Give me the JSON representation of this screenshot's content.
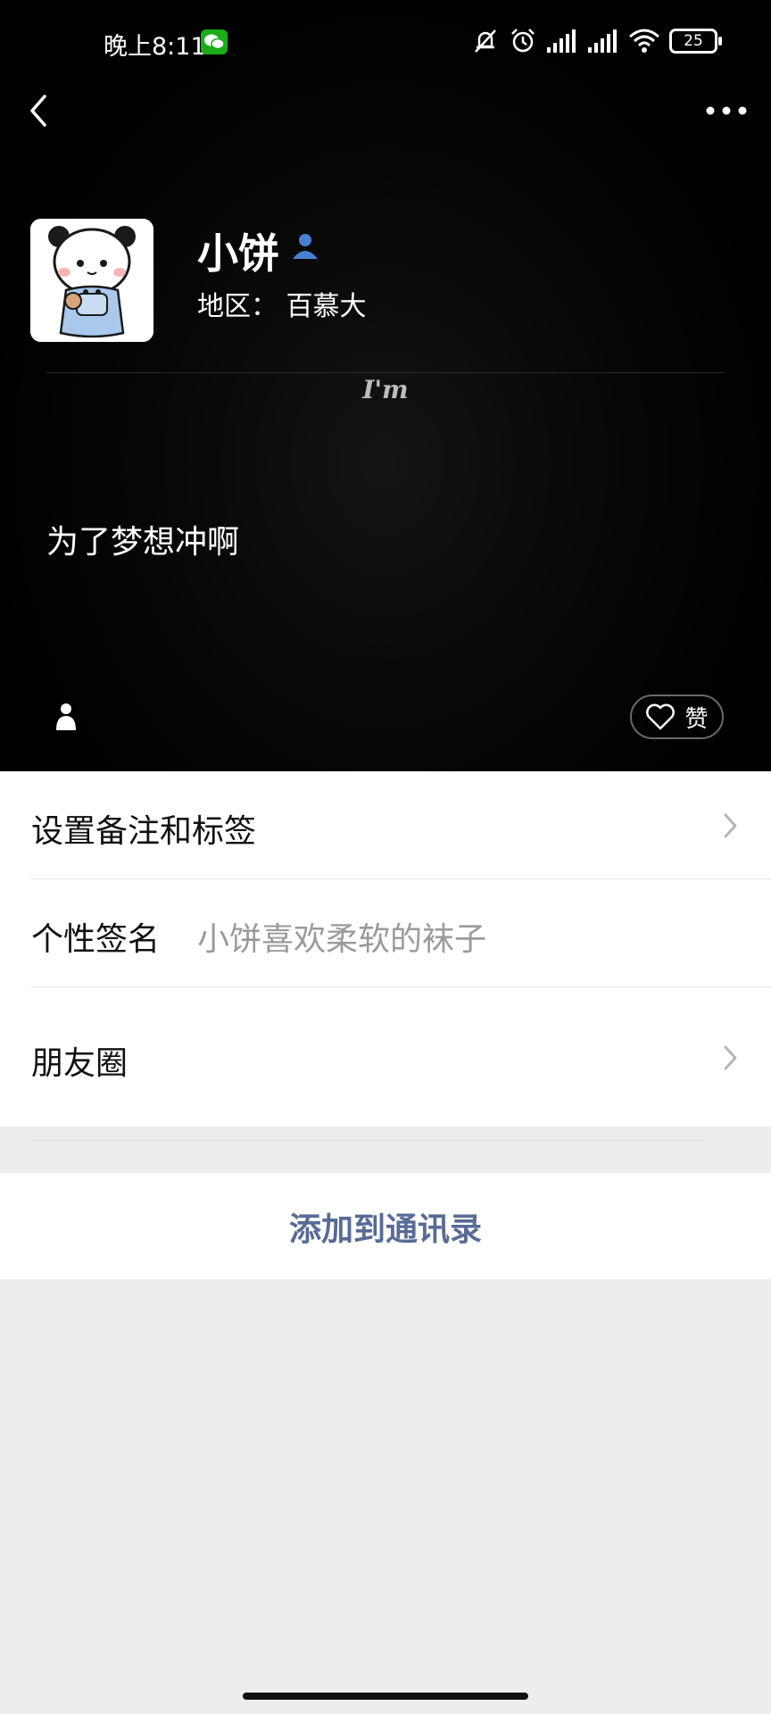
{
  "status_bar": {
    "time": "晚上8:11",
    "battery": "25",
    "icons": [
      "wechat-notification-icon",
      "mute-bell-icon",
      "alarm-icon",
      "signal-icon",
      "signal-icon",
      "wifi-icon",
      "battery-icon"
    ]
  },
  "header": {
    "back_icon": "chevron-left-icon",
    "more_icon": "more-dots-icon"
  },
  "profile": {
    "avatar": "panda-avatar",
    "nickname": "小饼",
    "friend_icon": "friend-person-icon",
    "region": "地区：  百慕大",
    "cover_text": "I'm",
    "status_text": "为了梦想冲啊",
    "like_label": "赞",
    "colors": {
      "accent_blue": "#4a7fd6",
      "link_blue": "#576b95"
    }
  },
  "menu": {
    "items": [
      {
        "label": "设置备注和标签",
        "chevron": true
      },
      {
        "label": "个性签名",
        "value": "小饼喜欢柔软的袜子"
      },
      {
        "label": "朋友圈",
        "chevron": true
      }
    ]
  },
  "actions": {
    "add_contact": "添加到通讯录"
  }
}
